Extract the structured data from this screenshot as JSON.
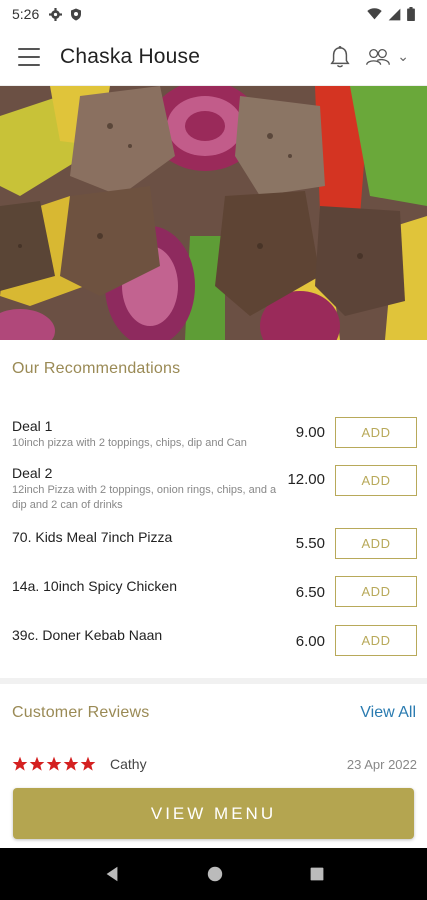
{
  "status_bar": {
    "time": "5:26"
  },
  "header": {
    "title": "Chaska House"
  },
  "recommendations": {
    "title": "Our Recommendations",
    "items": [
      {
        "name": "Deal 1",
        "description": "10inch pizza with 2 toppings, chips, dip and Can",
        "price": "9.00",
        "button": "ADD"
      },
      {
        "name": "Deal 2",
        "description": "12inch Pizza with 2 toppings, onion rings, chips, and a dip and 2 can of drinks",
        "price": "12.00",
        "button": "ADD"
      },
      {
        "name": "70. Kids Meal 7inch Pizza",
        "description": "",
        "price": "5.50",
        "button": "ADD"
      },
      {
        "name": "14a. 10inch Spicy Chicken",
        "description": "",
        "price": "6.50",
        "button": "ADD"
      },
      {
        "name": "39c. Doner Kebab Naan",
        "description": "",
        "price": "6.00",
        "button": "ADD"
      }
    ]
  },
  "reviews": {
    "title": "Customer Reviews",
    "view_all": "View All",
    "items": [
      {
        "rating": 5,
        "name": "Cathy",
        "date": "23 Apr 2022"
      }
    ]
  },
  "cta": {
    "label": "VIEW MENU"
  },
  "colors": {
    "accent": "#b4a550",
    "section_title": "#9a8a55",
    "link": "#2a7bb0",
    "star": "#d42020"
  }
}
